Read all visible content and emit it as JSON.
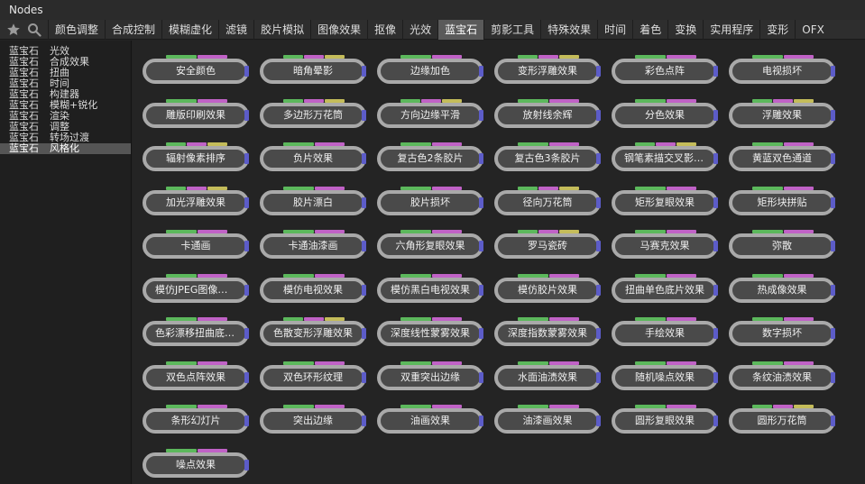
{
  "window": {
    "title": "Nodes"
  },
  "toolbar": {
    "tabs": [
      "颜色调整",
      "合成控制",
      "模糊虚化",
      "滤镜",
      "胶片模拟",
      "图像效果",
      "抠像",
      "光效",
      "蓝宝石",
      "剪影工具",
      "特殊效果",
      "时间",
      "着色",
      "变换",
      "实用程序",
      "变形",
      "OFX"
    ],
    "active_tab": "蓝宝石"
  },
  "sidebar": {
    "items": [
      {
        "category": "蓝宝石",
        "name": "光效"
      },
      {
        "category": "蓝宝石",
        "name": "合成效果"
      },
      {
        "category": "蓝宝石",
        "name": "扭曲"
      },
      {
        "category": "蓝宝石",
        "name": "时间"
      },
      {
        "category": "蓝宝石",
        "name": "构建器"
      },
      {
        "category": "蓝宝石",
        "name": "模糊+锐化"
      },
      {
        "category": "蓝宝石",
        "name": "渲染"
      },
      {
        "category": "蓝宝石",
        "name": "调整"
      },
      {
        "category": "蓝宝石",
        "name": "转场过渡"
      },
      {
        "category": "蓝宝石",
        "name": "风格化"
      }
    ],
    "selected": "风格化"
  },
  "nodes": [
    {
      "label": "安全颜色",
      "ports": [
        "g",
        "m"
      ]
    },
    {
      "label": "暗角晕影",
      "ports": [
        "g",
        "m",
        "y"
      ]
    },
    {
      "label": "边缘加色",
      "ports": [
        "g",
        "m"
      ]
    },
    {
      "label": "变形浮雕效果",
      "ports": [
        "g",
        "m",
        "y"
      ]
    },
    {
      "label": "彩色点阵",
      "ports": [
        "g",
        "m"
      ]
    },
    {
      "label": "电视损坏",
      "ports": [
        "g",
        "m"
      ]
    },
    {
      "label": "雕版印刷效果",
      "ports": [
        "g",
        "m"
      ]
    },
    {
      "label": "多边形万花筒",
      "ports": [
        "g",
        "m",
        "y"
      ]
    },
    {
      "label": "方向边缘平滑",
      "ports": [
        "g",
        "m",
        "y"
      ]
    },
    {
      "label": "放射线余辉",
      "ports": [
        "g",
        "m"
      ]
    },
    {
      "label": "分色效果",
      "ports": [
        "g",
        "m"
      ]
    },
    {
      "label": "浮雕效果",
      "ports": [
        "g",
        "m",
        "y"
      ]
    },
    {
      "label": "辐射像素排序",
      "ports": [
        "g",
        "m",
        "y"
      ]
    },
    {
      "label": "负片效果",
      "ports": [
        "g",
        "m"
      ]
    },
    {
      "label": "复古色2条胶片",
      "ports": [
        "g",
        "m"
      ]
    },
    {
      "label": "复古色3条胶片",
      "ports": [
        "g",
        "m"
      ]
    },
    {
      "label": "钢笔素描交叉影线画",
      "ports": [
        "g",
        "m",
        "y"
      ]
    },
    {
      "label": "黄蓝双色通道",
      "ports": [
        "g",
        "m"
      ]
    },
    {
      "label": "加光浮雕效果",
      "ports": [
        "g",
        "m",
        "y"
      ]
    },
    {
      "label": "胶片漂白",
      "ports": [
        "g",
        "m"
      ]
    },
    {
      "label": "胶片损坏",
      "ports": [
        "g",
        "m"
      ]
    },
    {
      "label": "径向万花筒",
      "ports": [
        "g",
        "m",
        "y"
      ]
    },
    {
      "label": "矩形复眼效果",
      "ports": [
        "g",
        "m"
      ]
    },
    {
      "label": "矩形块拼贴",
      "ports": [
        "g",
        "m"
      ]
    },
    {
      "label": "卡通画",
      "ports": [
        "g",
        "m"
      ]
    },
    {
      "label": "卡通油漆画",
      "ports": [
        "g",
        "m"
      ]
    },
    {
      "label": "六角形复眼效果",
      "ports": [
        "g",
        "m"
      ]
    },
    {
      "label": "罗马瓷砖",
      "ports": [
        "g",
        "m",
        "y"
      ]
    },
    {
      "label": "马赛克效果",
      "ports": [
        "g",
        "m"
      ]
    },
    {
      "label": "弥散",
      "ports": [
        "g",
        "m"
      ]
    },
    {
      "label": "模仿JPEG图像损失",
      "ports": [
        "g",
        "m"
      ]
    },
    {
      "label": "模仿电视效果",
      "ports": [
        "g",
        "m"
      ]
    },
    {
      "label": "模仿黑白电视效果",
      "ports": [
        "g",
        "m"
      ]
    },
    {
      "label": "模仿胶片效果",
      "ports": [
        "g",
        "m"
      ]
    },
    {
      "label": "扭曲单色底片效果",
      "ports": [
        "g",
        "m"
      ]
    },
    {
      "label": "热成像效果",
      "ports": [
        "g",
        "m"
      ]
    },
    {
      "label": "色彩漂移扭曲底片…",
      "ports": [
        "g",
        "m"
      ]
    },
    {
      "label": "色散变形浮雕效果",
      "ports": [
        "g",
        "m",
        "y"
      ]
    },
    {
      "label": "深度线性蒙雾效果",
      "ports": [
        "g",
        "m"
      ]
    },
    {
      "label": "深度指数蒙雾效果",
      "ports": [
        "g",
        "m"
      ]
    },
    {
      "label": "手绘效果",
      "ports": [
        "g",
        "m"
      ]
    },
    {
      "label": "数字损坏",
      "ports": [
        "g",
        "m"
      ]
    },
    {
      "label": "双色点阵效果",
      "ports": [
        "g",
        "m"
      ]
    },
    {
      "label": "双色环形纹理",
      "ports": [
        "g",
        "m"
      ]
    },
    {
      "label": "双重突出边缘",
      "ports": [
        "g",
        "m"
      ]
    },
    {
      "label": "水面油渍效果",
      "ports": [
        "g",
        "m"
      ]
    },
    {
      "label": "随机噪点效果",
      "ports": [
        "g",
        "m"
      ]
    },
    {
      "label": "条纹油渍效果",
      "ports": [
        "g",
        "m"
      ]
    },
    {
      "label": "条形幻灯片",
      "ports": [
        "g",
        "m"
      ]
    },
    {
      "label": "突出边缘",
      "ports": [
        "g",
        "m"
      ]
    },
    {
      "label": "油画效果",
      "ports": [
        "g",
        "m"
      ]
    },
    {
      "label": "油漆画效果",
      "ports": [
        "g",
        "m"
      ]
    },
    {
      "label": "圆形复眼效果",
      "ports": [
        "g",
        "m"
      ]
    },
    {
      "label": "圆形万花筒",
      "ports": [
        "g",
        "m",
        "y"
      ]
    },
    {
      "label": "噪点效果",
      "ports": [
        "g",
        "m"
      ]
    }
  ],
  "colors": {
    "port_green": "#5cb85c",
    "port_magenta": "#c062c6",
    "port_yellow": "#c4bc5a",
    "output_port": "#5c5cc8",
    "node_border": "#a9a9a9",
    "node_fill": "#4a4a4a",
    "active_tab": "#5a5a5a"
  },
  "icons": [
    "star-icon",
    "search-icon"
  ]
}
